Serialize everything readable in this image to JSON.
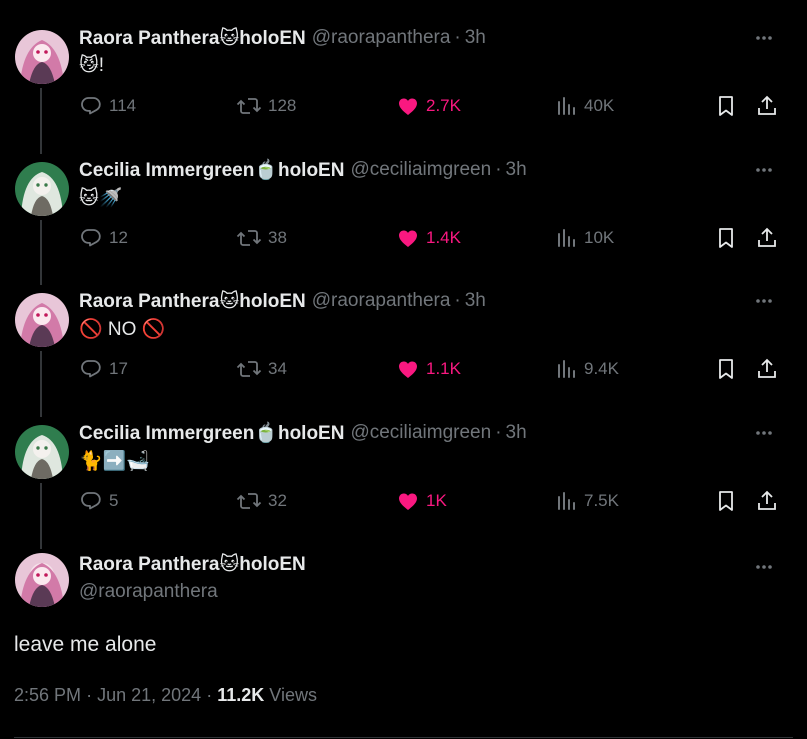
{
  "colors": {
    "accent_like": "#f91880",
    "muted": "#71767b",
    "text": "#e7e9ea",
    "bg": "#000000"
  },
  "replies": [
    {
      "name": "Raora Panthera🐱holoEN",
      "handle": "@raorapanthera",
      "time": "3h",
      "text": "😼!",
      "avatar": "raora-avatar",
      "reply_count": "114",
      "retweet_count": "128",
      "like_count": "2.7K",
      "view_count": "40K"
    },
    {
      "name": "Cecilia Immergreen🍵holoEN",
      "handle": "@ceciliaimgreen",
      "time": "3h",
      "text": "🐱🚿",
      "avatar": "cecilia-avatar",
      "reply_count": "12",
      "retweet_count": "38",
      "like_count": "1.4K",
      "view_count": "10K"
    },
    {
      "name": "Raora Panthera🐱holoEN",
      "handle": "@raorapanthera",
      "time": "3h",
      "text": "🚫 NO 🚫",
      "avatar": "raora-avatar",
      "reply_count": "17",
      "retweet_count": "34",
      "like_count": "1.1K",
      "view_count": "9.4K"
    },
    {
      "name": "Cecilia Immergreen🍵holoEN",
      "handle": "@ceciliaimgreen",
      "time": "3h",
      "text": "🐈➡️🛁",
      "avatar": "cecilia-avatar",
      "reply_count": "5",
      "retweet_count": "32",
      "like_count": "1K",
      "view_count": "7.5K"
    }
  ],
  "main": {
    "name": "Raora Panthera🐱holoEN",
    "handle": "@raorapanthera",
    "text": "leave me alone",
    "time": "2:56 PM",
    "date": "Jun 21, 2024",
    "views": "11.2K",
    "views_label": "Views",
    "separator": "·"
  }
}
